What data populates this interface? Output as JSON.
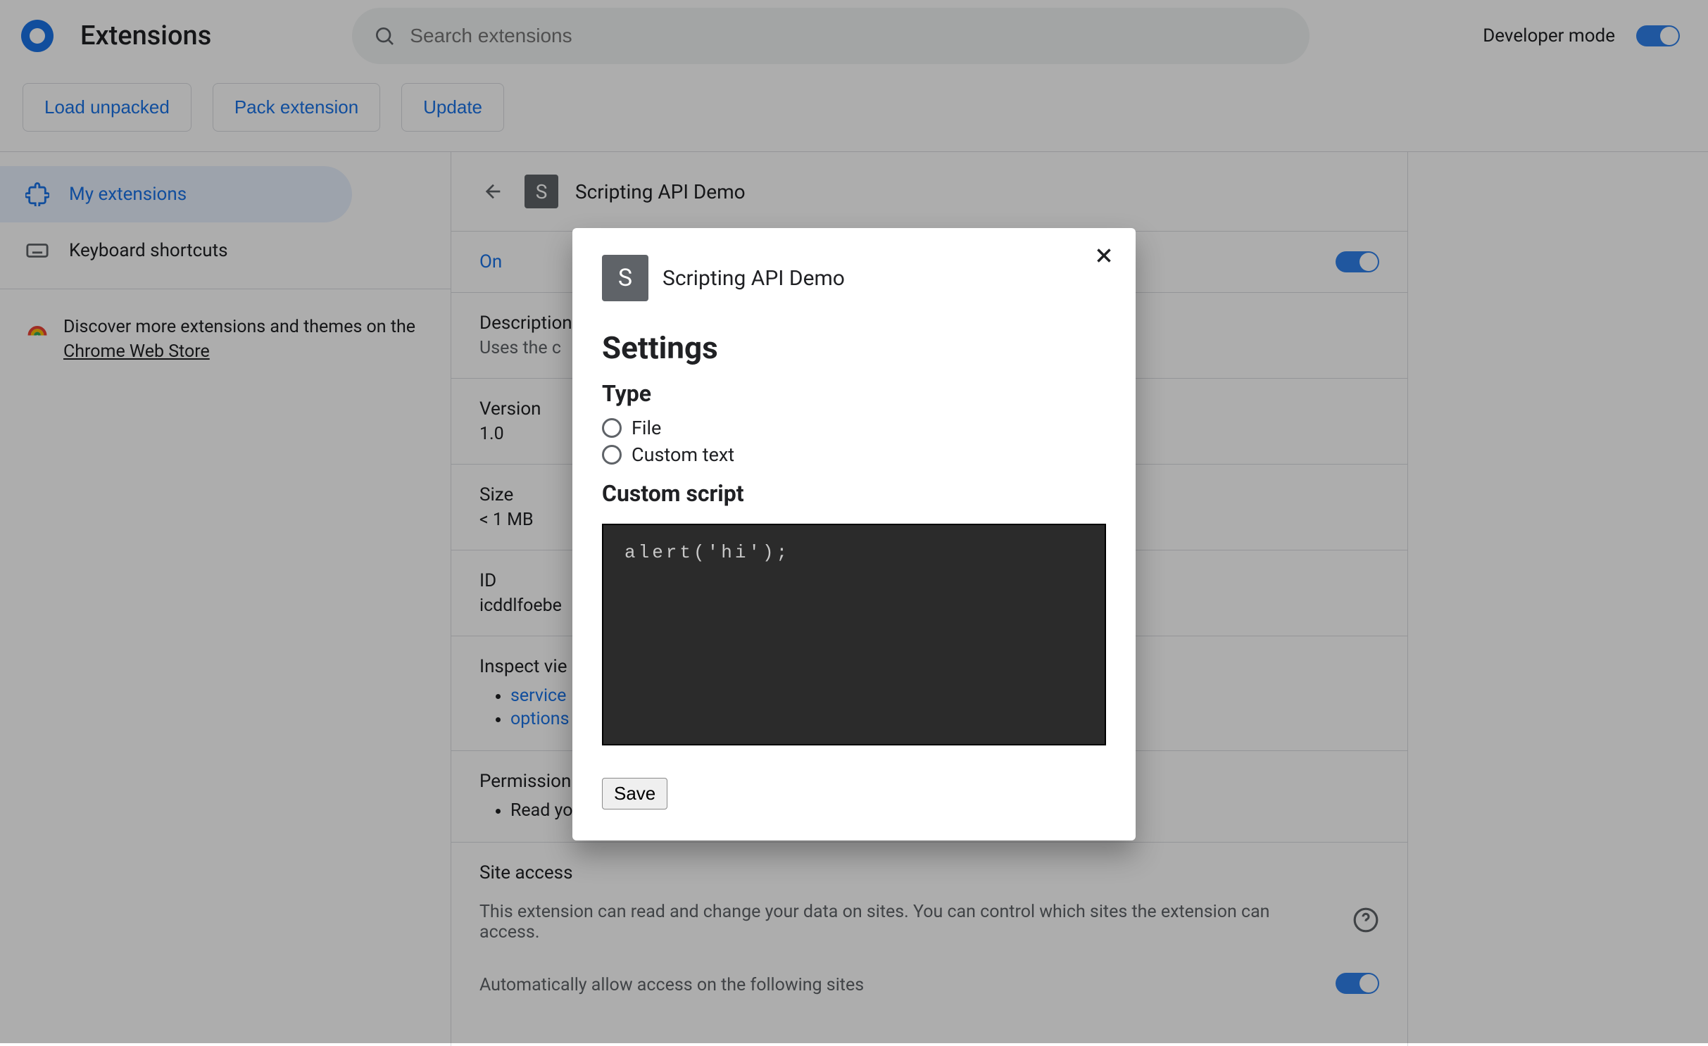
{
  "header": {
    "title": "Extensions",
    "search_placeholder": "Search extensions",
    "dev_mode_label": "Developer mode"
  },
  "actions": {
    "load_unpacked": "Load unpacked",
    "pack_extension": "Pack extension",
    "update": "Update"
  },
  "sidebar": {
    "my_extensions": "My extensions",
    "keyboard_shortcuts": "Keyboard shortcuts",
    "discover_pre": "Discover more extensions and themes on the ",
    "discover_link": "Chrome Web Store"
  },
  "ext": {
    "name": "Scripting API Demo",
    "icon_letter": "S",
    "on_label": "On",
    "desc_label": "Description",
    "desc_value": "Uses the c",
    "version_label": "Version",
    "version_value": "1.0",
    "size_label": "Size",
    "size_value": "< 1 MB",
    "id_label": "ID",
    "id_value": "icddlfoebe",
    "inspect_label": "Inspect vie",
    "inspect_links": [
      "service",
      "options"
    ],
    "permissions_label": "Permission",
    "permissions_items": [
      "Read yo"
    ],
    "site_access_label": "Site access",
    "site_access_desc": "This extension can read and change your data on sites. You can control which sites the extension can access.",
    "auto_allow_label": "Automatically allow access on the following sites"
  },
  "dialog": {
    "icon_letter": "S",
    "title": "Scripting API Demo",
    "settings_heading": "Settings",
    "type_heading": "Type",
    "type_options": [
      "File",
      "Custom text"
    ],
    "custom_heading": "Custom script",
    "code_value": "alert('hi');",
    "save_label": "Save"
  }
}
